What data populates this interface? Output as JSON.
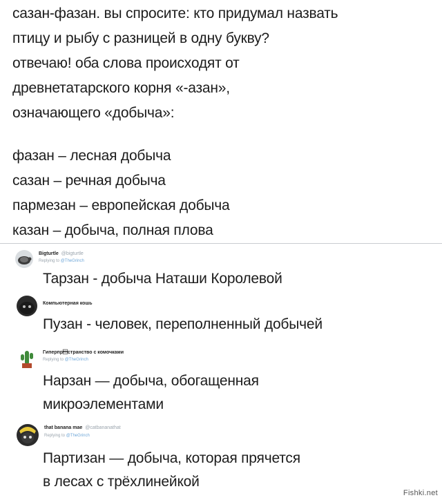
{
  "top_tweet": {
    "lines": [
      "сазан-фазан. вы спросите: кто придумал назвать",
      "птицу и рыбу с разницей в одну букву?",
      "отвечаю! оба слова происходят от",
      "древнетатарского корня «-азан»,",
      "означающего «добыча»:",
      "фазан – лесная добыча",
      "сазан – речная добыча",
      "пармезан – европейская добыча",
      "казан – добыча, полная плова"
    ]
  },
  "replies": [
    {
      "name": "Bigturtle",
      "handle": "@bigturtle",
      "replying_to_label": "Replying to",
      "replying_to_user": "@TheGrinch",
      "text_lines": [
        "Тарзан - добыча Наташи Королевой"
      ]
    },
    {
      "name": "Компьютерная кошь",
      "handle": "",
      "replying_to_label": "",
      "replying_to_user": "",
      "text_lines": [
        "Пузан - человек, переполненный добычей"
      ]
    },
    {
      "name": "Гиперпр\u0001странство с комочками",
      "handle": "",
      "replying_to_label": "Replying to",
      "replying_to_user": "@TheGrinch",
      "text_lines": [
        "Нарзан — добыча, обогащенная",
        "микроэлементами"
      ]
    },
    {
      "name": "that banana mae",
      "handle": "@catbananathat",
      "replying_to_label": "Replying to",
      "replying_to_user": "@TheGrinch",
      "text_lines": [
        "Партизан — добыча, которая прячется",
        "в лесах с трёхлинейкой"
      ]
    }
  ],
  "watermark": "Fishki.net",
  "colors": {
    "text": "#1c1c1c",
    "muted": "#9aa4ad",
    "mention": "#6fa7d8",
    "divider": "#c9ccd0"
  },
  "icons": [
    "turtle-avatar-icon",
    "cat-avatar-icon",
    "cactus-avatar-icon",
    "banana-cat-avatar-icon"
  ]
}
